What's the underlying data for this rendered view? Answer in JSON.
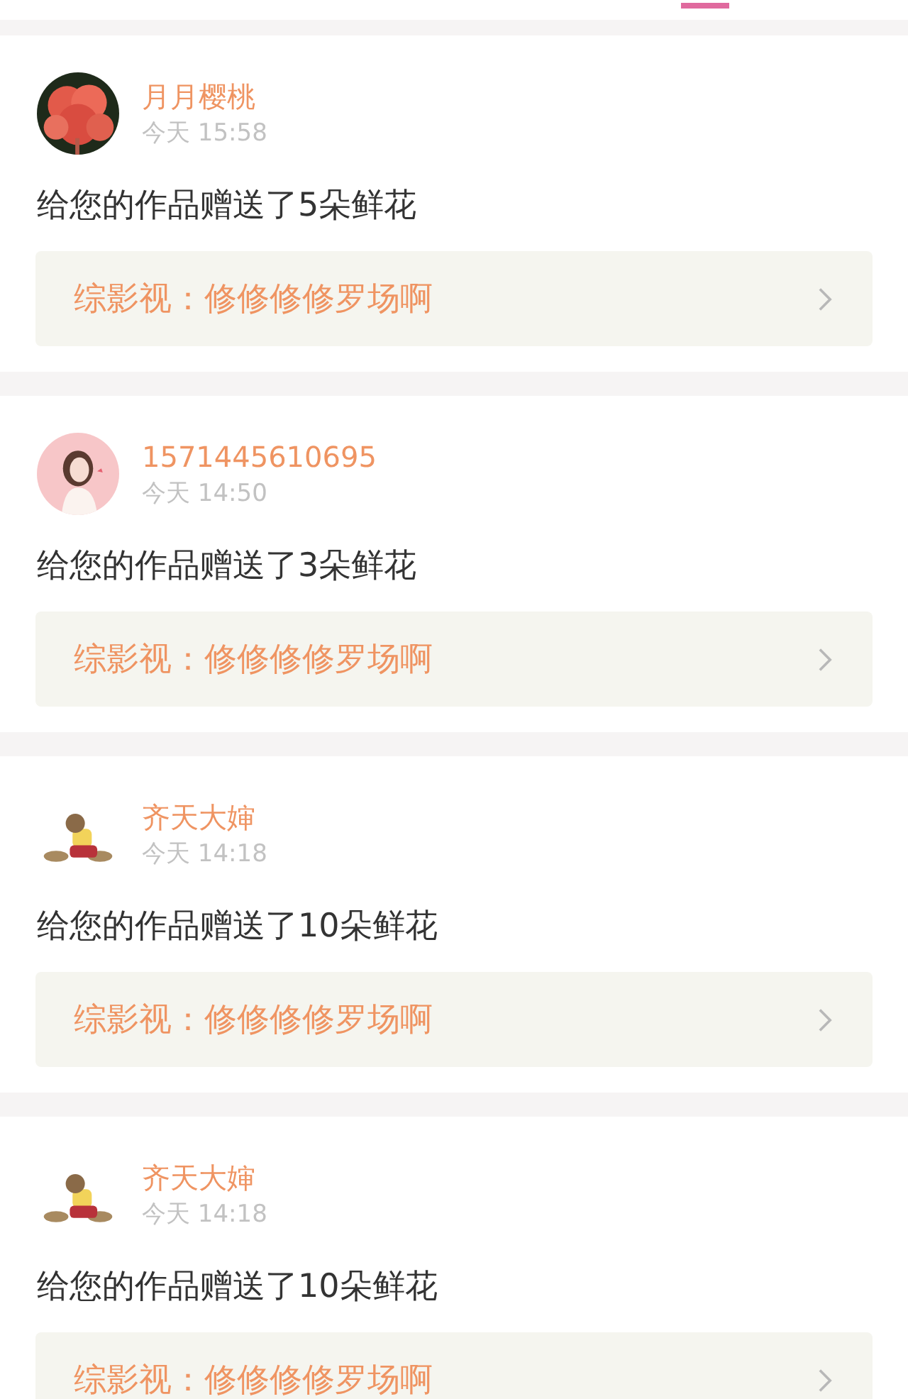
{
  "notifications": [
    {
      "name": "月月樱桃",
      "time": "今天 15:58",
      "message": "给您的作品赠送了5朵鲜花",
      "work": "综影视：修修修修罗场啊"
    },
    {
      "name": "1571445610695",
      "time": "今天 14:50",
      "message": "给您的作品赠送了3朵鲜花",
      "work": "综影视：修修修修罗场啊"
    },
    {
      "name": "齐天大婶",
      "time": "今天 14:18",
      "message": "给您的作品赠送了10朵鲜花",
      "work": "综影视：修修修修罗场啊"
    },
    {
      "name": "齐天大婶",
      "time": "今天 14:18",
      "message": "给您的作品赠送了10朵鲜花",
      "work": "综影视：修修修修罗场啊"
    }
  ]
}
